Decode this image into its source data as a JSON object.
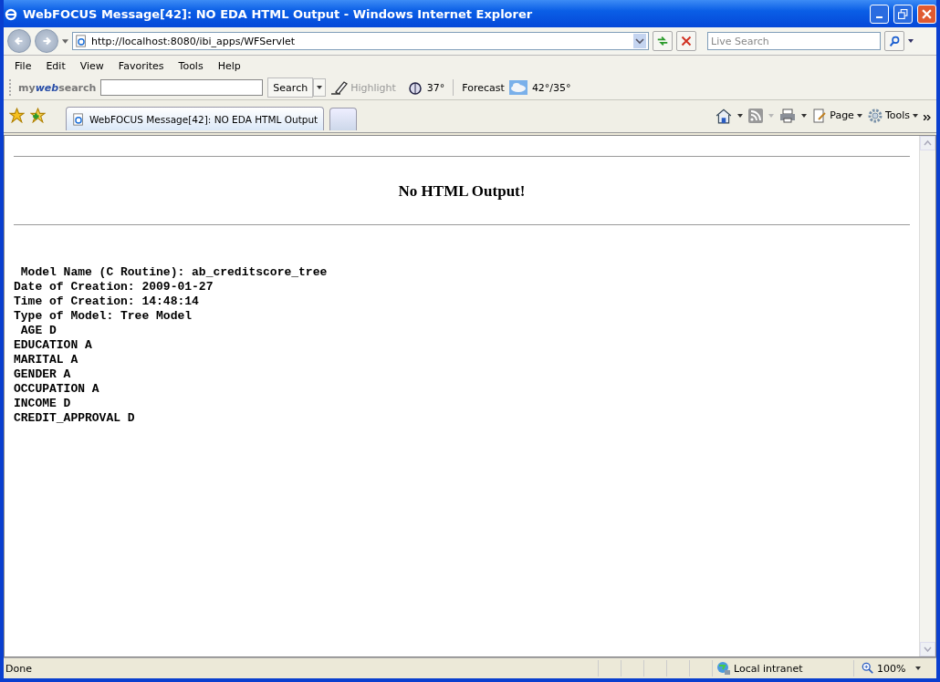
{
  "window": {
    "title": "WebFOCUS Message[42]: NO EDA HTML Output - Windows Internet Explorer"
  },
  "address_bar": {
    "url": "http://localhost:8080/ibi_apps/WFServlet"
  },
  "live_search": {
    "placeholder": "Live Search"
  },
  "menu": [
    "File",
    "Edit",
    "View",
    "Favorites",
    "Tools",
    "Help"
  ],
  "search_toolbar": {
    "logo": "my**web**search",
    "button": "Search",
    "highlight": {
      "label": "Highlight",
      "disabled": true
    },
    "temperature": "37°",
    "forecast_label": "Forecast",
    "forecast": "42°/35°"
  },
  "tabs": [
    {
      "label": "WebFOCUS Message[42]: NO EDA HTML Output",
      "selected": true
    }
  ],
  "command_bar": {
    "page": "Page",
    "tools": "Tools"
  },
  "content": {
    "heading": "No HTML Output!",
    "lines": [
      " Model Name (C Routine): ab_creditscore_tree",
      "Date of Creation: 2009-01-27",
      "Time of Creation: 14:48:14",
      "Type of Model: Tree Model",
      " AGE D",
      "EDUCATION A",
      "MARITAL A",
      "GENDER A",
      "OCCUPATION A",
      "INCOME D",
      "CREDIT_APPROVAL D"
    ]
  },
  "status_bar": {
    "status": "Done",
    "zone": "Local intranet",
    "zoom": "100%"
  }
}
